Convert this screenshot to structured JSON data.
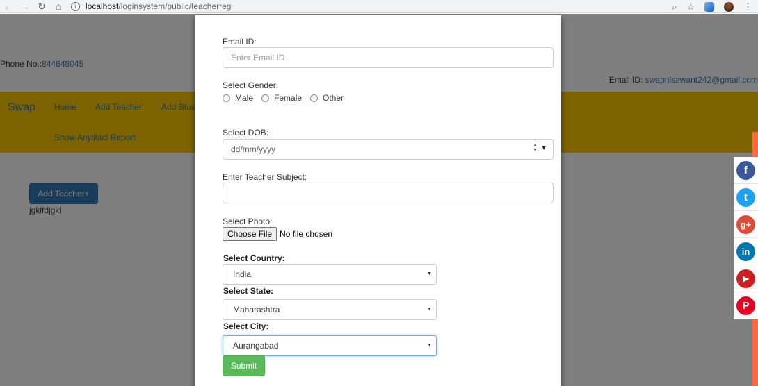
{
  "browser": {
    "url_host": "localhost",
    "url_path": "/loginsystem/public/teacherreg"
  },
  "page": {
    "phone_label": "Phone No.:",
    "phone_value": "844648045",
    "email_label": "Email ID: ",
    "email_value": "swapnlsawant242@gmail.com",
    "brand": "Swap",
    "nav": [
      "Home",
      "Add Teacher",
      "Add Stud",
      "Show Anylitacl Report"
    ],
    "add_teacher_button": "Add Teacher+",
    "misc_text": "jgklfdjgkl"
  },
  "form": {
    "email_label": "Email ID:",
    "email_placeholder": "Enter Email ID",
    "gender_label": "Select Gender:",
    "gender_options": [
      "Male",
      "Female",
      "Other"
    ],
    "dob_label": "Select DOB:",
    "dob_placeholder": "dd/mm/yyyy",
    "subject_label": "Enter Teacher Subject:",
    "photo_label": "Select Photo:",
    "choose_file": "Choose File",
    "file_status": "No file chosen",
    "country_label": "Select Country:",
    "country_value": "India",
    "state_label": "Select State:",
    "state_value": "Maharashtra",
    "city_label": "Select City:",
    "city_value": "Aurangabad",
    "submit": "Submit"
  },
  "social": [
    {
      "name": "facebook",
      "glyph": "f",
      "color": "#3b5998"
    },
    {
      "name": "twitter",
      "glyph": "t",
      "color": "#1da1f2"
    },
    {
      "name": "google-plus",
      "glyph": "g+",
      "color": "#dd4b39"
    },
    {
      "name": "linkedin",
      "glyph": "in",
      "color": "#0077b5"
    },
    {
      "name": "youtube",
      "glyph": "▶",
      "color": "#cd201f"
    },
    {
      "name": "pinterest",
      "glyph": "P",
      "color": "#e60023"
    }
  ]
}
